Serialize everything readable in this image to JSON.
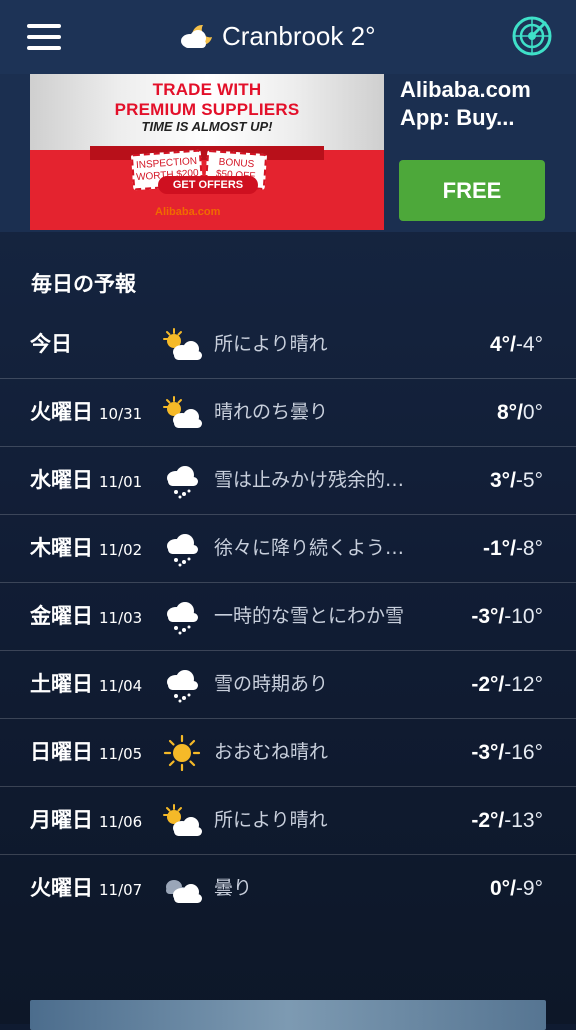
{
  "header": {
    "location": "Cranbrook",
    "temp": "2°",
    "title_icon": "partly-cloudy-night-icon",
    "menu_icon": "hamburger-menu-icon",
    "radar_icon": "radar-icon"
  },
  "ad": {
    "headline_line1": "TRADE WITH",
    "headline_line2": "PREMIUM SUPPLIERS",
    "tagline": "TIME IS ALMOST UP!",
    "coupon1_line1": "INSPECTION",
    "coupon1_line2": "WORTH $200",
    "coupon2_line1": "BONUS",
    "coupon2_line2": "$50 OFF",
    "cta": "GET OFFERS",
    "brand": "Alibaba.com",
    "app_name": "Alibaba.com App: Buy...",
    "button": "FREE"
  },
  "forecast": {
    "title": "毎日の予報",
    "days": [
      {
        "day": "今日",
        "date": "",
        "icon": "partly-sunny-icon",
        "condition": "所により晴れ",
        "hi": "4°",
        "lo": "-4°"
      },
      {
        "day": "火曜日",
        "date": "10/31",
        "icon": "partly-sunny-icon",
        "condition": "晴れのち曇り",
        "hi": "8°",
        "lo": "0°"
      },
      {
        "day": "水曜日",
        "date": "11/01",
        "icon": "snow-cloud-icon",
        "condition": "雪は止みかけ残余的…",
        "hi": "3°",
        "lo": "-5°"
      },
      {
        "day": "木曜日",
        "date": "11/02",
        "icon": "snow-cloud-icon",
        "condition": "徐々に降り続くよう…",
        "hi": "-1°",
        "lo": "-8°"
      },
      {
        "day": "金曜日",
        "date": "11/03",
        "icon": "snow-cloud-icon",
        "condition": "一時的な雪とにわか雪",
        "hi": "-3°",
        "lo": "-10°"
      },
      {
        "day": "土曜日",
        "date": "11/04",
        "icon": "snow-cloud-icon",
        "condition": "雪の時期あり",
        "hi": "-2°",
        "lo": "-12°"
      },
      {
        "day": "日曜日",
        "date": "11/05",
        "icon": "sun-icon",
        "condition": "おおむね晴れ",
        "hi": "-3°",
        "lo": "-16°"
      },
      {
        "day": "月曜日",
        "date": "11/06",
        "icon": "partly-sunny-icon",
        "condition": "所により晴れ",
        "hi": "-2°",
        "lo": "-13°"
      },
      {
        "day": "火曜日",
        "date": "11/07",
        "icon": "cloudy-icon",
        "condition": "曇り",
        "hi": "0°",
        "lo": "-9°"
      }
    ]
  },
  "colors": {
    "accent_green": "#4da83a",
    "background": "#111d35",
    "header": "#1d3356",
    "sun": "#f5b928"
  }
}
